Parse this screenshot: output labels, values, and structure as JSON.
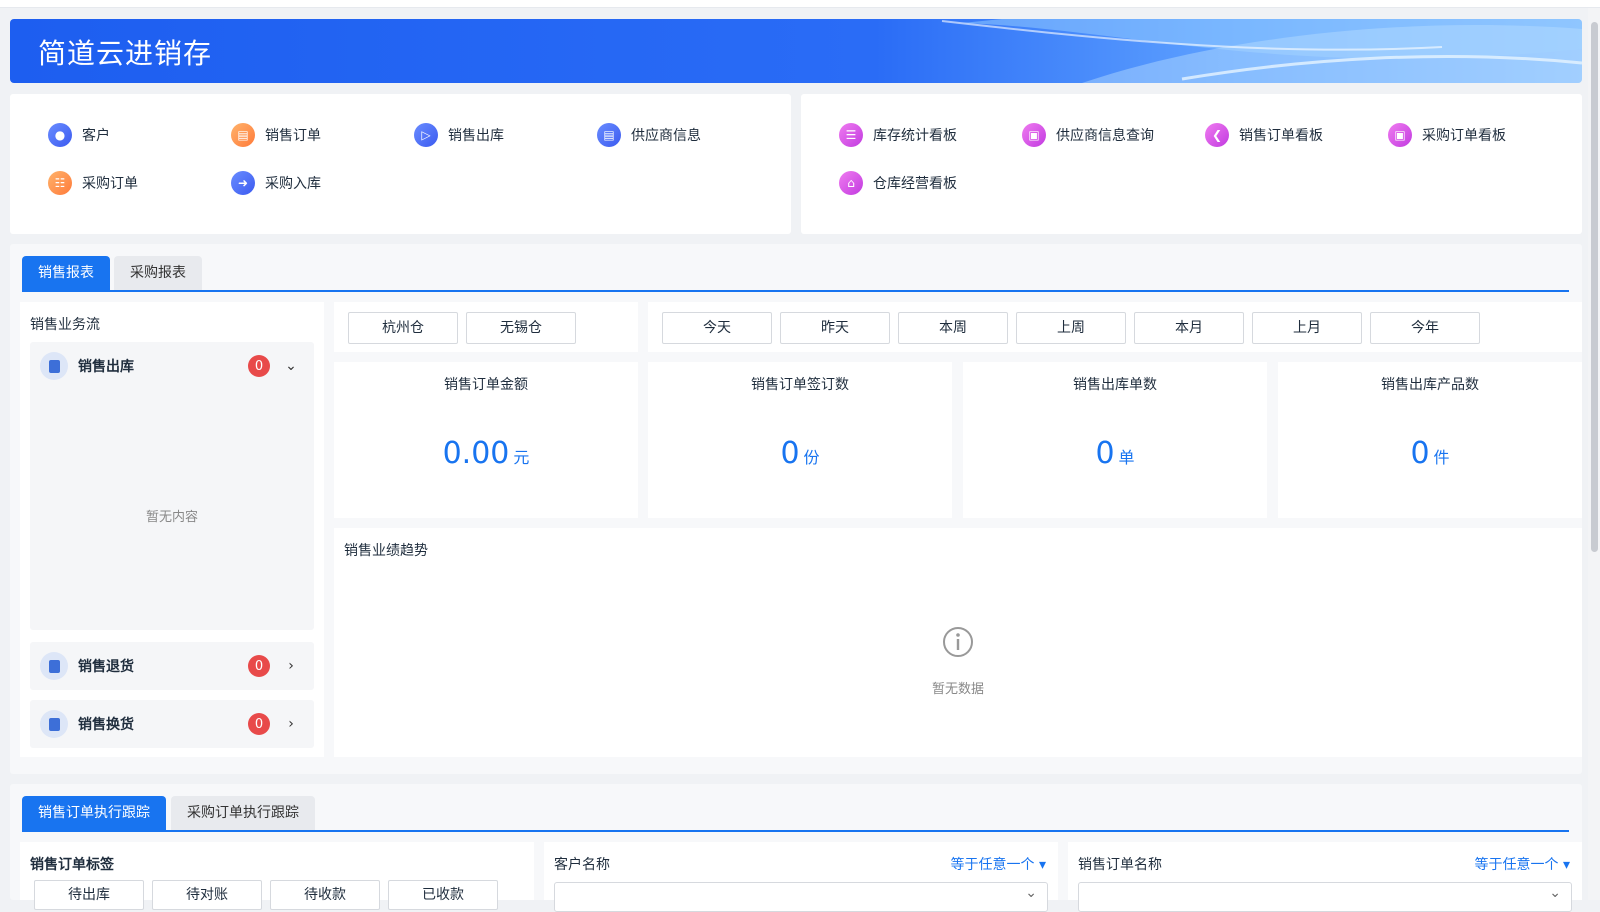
{
  "app": {
    "title": "简道云进销存"
  },
  "quick_links_left": [
    {
      "label": "客户",
      "icon": "customer-icon"
    },
    {
      "label": "销售订单",
      "icon": "sales-order-icon"
    },
    {
      "label": "销售出库",
      "icon": "sales-outbound-icon"
    },
    {
      "label": "供应商信息",
      "icon": "supplier-info-icon"
    },
    {
      "label": "采购订单",
      "icon": "purchase-order-icon"
    },
    {
      "label": "采购入库",
      "icon": "purchase-inbound-icon"
    }
  ],
  "quick_links_right": [
    {
      "label": "库存统计看板",
      "icon": "inventory-dashboard-icon"
    },
    {
      "label": "供应商信息查询",
      "icon": "supplier-query-icon"
    },
    {
      "label": "销售订单看板",
      "icon": "sales-dashboard-icon"
    },
    {
      "label": "采购订单看板",
      "icon": "purchase-dashboard-icon"
    },
    {
      "label": "仓库经营看板",
      "icon": "warehouse-dashboard-icon"
    }
  ],
  "report_tabs": [
    {
      "label": "销售报表",
      "active": true
    },
    {
      "label": "采购报表",
      "active": false
    }
  ],
  "flow": {
    "title": "销售业务流",
    "empty_text": "暂无内容",
    "items": [
      {
        "label": "销售出库",
        "count": "0",
        "expanded": true
      },
      {
        "label": "销售退货",
        "count": "0",
        "expanded": false
      },
      {
        "label": "销售换货",
        "count": "0",
        "expanded": false
      }
    ]
  },
  "warehouses": [
    "杭州仓",
    "无锡仓"
  ],
  "periods": [
    "今天",
    "昨天",
    "本周",
    "上周",
    "本月",
    "上月",
    "今年"
  ],
  "stats": [
    {
      "label": "销售订单金额",
      "value": "0.00",
      "unit": "元"
    },
    {
      "label": "销售订单签订数",
      "value": "0",
      "unit": "份"
    },
    {
      "label": "销售出库单数",
      "value": "0",
      "unit": "单"
    },
    {
      "label": "销售出库产品数",
      "value": "0",
      "unit": "件"
    }
  ],
  "trend": {
    "title": "销售业绩趋势",
    "empty_text": "暂无数据"
  },
  "tracking_tabs": [
    {
      "label": "销售订单执行跟踪",
      "active": true
    },
    {
      "label": "采购订单执行跟踪",
      "active": false
    }
  ],
  "tracking": {
    "tag_title": "销售订单标签",
    "tags": [
      "待出库",
      "待对账",
      "待收款",
      "已收款"
    ],
    "customer_label": "客户名称",
    "customer_op": "等于任意一个",
    "order_label": "销售订单名称",
    "order_op": "等于任意一个"
  },
  "colors": {
    "primary": "#1874f0",
    "badge": "#e84a4a",
    "banner": "#2a6cf6"
  }
}
